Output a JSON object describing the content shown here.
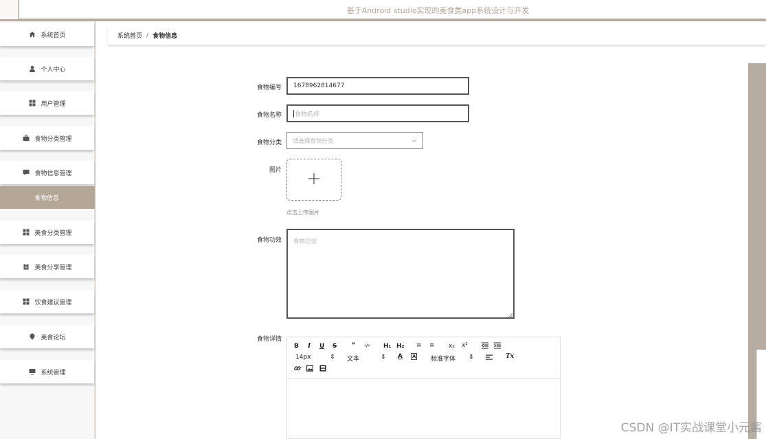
{
  "header": {
    "title": "基于Android studio实现的美食类app系统设计与开发"
  },
  "sidebar": {
    "items": [
      {
        "label": "系统首页",
        "icon": "home-icon"
      },
      {
        "label": "个人中心",
        "icon": "user-icon"
      },
      {
        "label": "用户管理",
        "icon": "grid-icon"
      },
      {
        "label": "食物分类管理",
        "icon": "briefcase-icon"
      },
      {
        "label": "食物信息管理",
        "icon": "chat-icon"
      },
      {
        "label": "美食分类管理",
        "icon": "grid-icon"
      },
      {
        "label": "美食分享管理",
        "icon": "clipboard-icon"
      },
      {
        "label": "饮食建议管理",
        "icon": "grid-icon"
      },
      {
        "label": "美食论坛",
        "icon": "pin-icon"
      },
      {
        "label": "系统管理",
        "icon": "monitor-icon"
      }
    ],
    "active_sub": "食物信息"
  },
  "breadcrumb": {
    "home": "系统首页",
    "separator": "/",
    "current": "食物信息"
  },
  "form": {
    "food_id_label": "食物编号",
    "food_id_value": "1678962814677",
    "food_name_label": "食物名称",
    "food_name_placeholder": "食物名称",
    "category_label": "食物分类",
    "category_placeholder": "请选择食物分类",
    "image_label": "图片",
    "upload_hint": "点击上传图片",
    "effect_label": "食物功效",
    "effect_placeholder": "食物功效",
    "detail_label": "食物详情"
  },
  "editor": {
    "bold": "B",
    "italic": "I",
    "underline": "U",
    "strike": "S",
    "quote": "❞",
    "code": "‹/›",
    "h1": "H₁",
    "h2": "H₂",
    "ordered_list": "≡",
    "bullet_list": "≡",
    "subscript": "x₂",
    "superscript": "x²",
    "font_size": "14px",
    "text_type": "文本",
    "font_color": "A",
    "bg_color": "A",
    "font_family": "标准字体",
    "clear_format": "Tx"
  },
  "watermark": "CSDN @IT实战课堂小元酱"
}
